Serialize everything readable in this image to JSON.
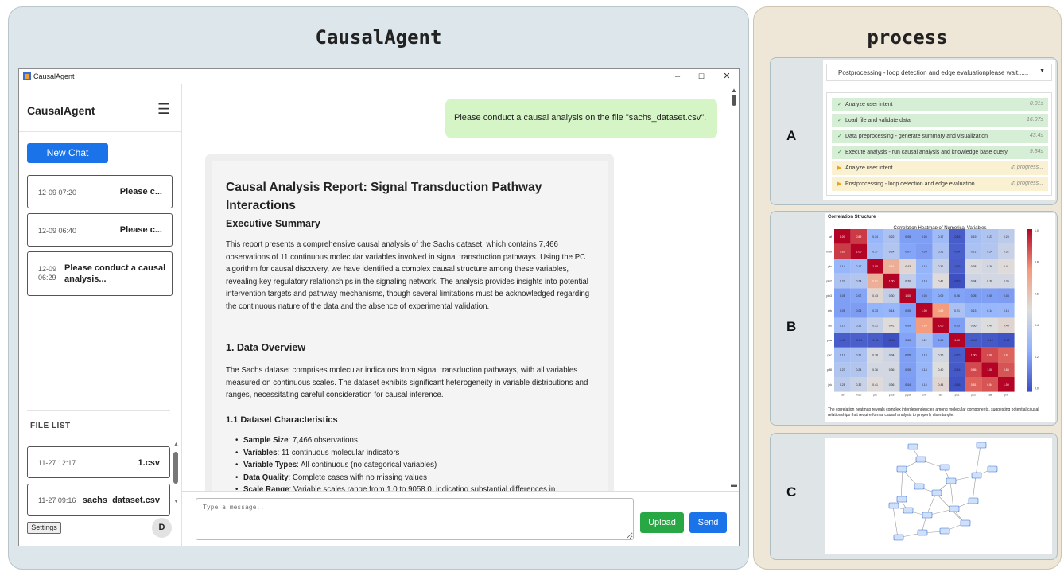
{
  "left_panel": {
    "title": "CausalAgent"
  },
  "right_panel": {
    "title": "process"
  },
  "window": {
    "app_name": "CausalAgent",
    "controls": {
      "minimize": "–",
      "maximize": "☐",
      "close": "✕"
    }
  },
  "sidebar": {
    "title": "CausalAgent",
    "menu_icon": "☰",
    "new_chat_label": "New Chat",
    "chats": [
      {
        "time": "12-09 07:20",
        "text": "Please c..."
      },
      {
        "time": "12-09 06:40",
        "text": "Please c..."
      },
      {
        "time_line1": "12-09",
        "time_line2": "06:29",
        "text_line1": "Please conduct a causal",
        "text_line2": "analysis..."
      }
    ],
    "file_list_label": "FILE LIST",
    "files": [
      {
        "time": "11-27 12:17",
        "name": "1.csv"
      },
      {
        "time": "11-27 09:16",
        "name": "sachs_dataset.csv"
      }
    ],
    "settings_label": "Settings",
    "avatar_letter": "D"
  },
  "chat": {
    "user_message": "Please conduct a causal analysis on the file \"sachs_dataset.csv\".",
    "report": {
      "title": "Causal Analysis Report: Signal Transduction Pathway Interactions",
      "exec_heading": "Executive Summary",
      "exec_text": "This report presents a comprehensive causal analysis of the Sachs dataset, which contains 7,466 observations of 11 continuous molecular variables involved in signal transduction pathways. Using the PC algorithm for causal discovery, we have identified a complex causal structure among these variables, revealing key regulatory relationships in the signaling network. The analysis provides insights into potential intervention targets and pathway mechanisms, though several limitations must be acknowledged regarding the continuous nature of the data and the absence of experimental validation.",
      "data_heading": "1. Data Overview",
      "data_text": "The Sachs dataset comprises molecular indicators from signal transduction pathways, with all variables measured on continuous scales. The dataset exhibits significant heterogeneity in variable distributions and ranges, necessitating careful consideration for causal inference.",
      "char_heading": "1.1 Dataset Characteristics",
      "bullets": [
        {
          "label": "Sample Size",
          "text": ": 7,466 observations"
        },
        {
          "label": "Variables",
          "text": ": 11 continuous molecular indicators"
        },
        {
          "label": "Variable Types",
          "text": ": All continuous (no categorical variables)"
        },
        {
          "label": "Data Quality",
          "text": ": Complete cases with no missing values"
        },
        {
          "label": "Scale Range",
          "text": ": Variable scales range from 1.0 to 9058.0, indicating substantial differences in"
        }
      ]
    },
    "input_placeholder": "Type a message...",
    "upload_label": "Upload",
    "send_label": "Send"
  },
  "process": {
    "A": {
      "label": "A",
      "header": "Postprocessing - loop detection and edge evaluationplease wait......",
      "header_arrow": "▼",
      "steps": [
        {
          "status": "done",
          "mark": "✓",
          "text": "Analyze user intent",
          "time": "0.01s"
        },
        {
          "status": "done",
          "mark": "✓",
          "text": "Load file and validate data",
          "time": "16.97s"
        },
        {
          "status": "done",
          "mark": "✓",
          "text": "Data preprocessing - generate summary and visualization",
          "time": "43.4s"
        },
        {
          "status": "done",
          "mark": "✓",
          "text": "Execute analysis - run causal analysis and knowledge base query",
          "time": "9.34s"
        },
        {
          "status": "prog",
          "mark": "▶",
          "text": "Analyze user intent",
          "time": "In progress..."
        },
        {
          "status": "prog",
          "mark": "▶",
          "text": "Postprocessing - loop detection and edge evaluation",
          "time": "In progress..."
        }
      ]
    },
    "B": {
      "label": "B",
      "section_title": "Correlation Structure",
      "heatmap_title": "Correlation Heatmap of Numerical Variables",
      "caption": "The correlation heatmap reveals complex interdependencies among molecular components, suggesting potential causal relationships that require formal causal analysis to properly disentangle.",
      "variables": [
        "raf",
        "mek",
        "plc",
        "pip2",
        "pip3",
        "erk",
        "akt",
        "pka",
        "pkc",
        "p38",
        "jnk"
      ],
      "colorbar_ticks": [
        "1.0",
        "0.8",
        "0.6",
        "0.4",
        "0.2",
        "0.0"
      ],
      "matrix": [
        [
          1.0,
          0.89,
          0.14,
          0.22,
          0.05,
          0.05,
          0.17,
          -0.15,
          0.19,
          0.23,
          0.28
        ],
        [
          0.89,
          1.0,
          0.17,
          0.24,
          0.07,
          0.04,
          0.21,
          -0.14,
          0.21,
          0.24,
          0.32
        ],
        [
          0.14,
          0.17,
          1.0,
          0.61,
          0.43,
          0.13,
          0.31,
          -0.15,
          0.38,
          0.36,
          0.41
        ],
        [
          0.22,
          0.24,
          0.61,
          1.0,
          0.3,
          0.14,
          0.41,
          -0.19,
          0.34,
          0.36,
          0.36
        ],
        [
          0.05,
          0.07,
          0.43,
          0.3,
          1.0,
          0.05,
          0.09,
          0.06,
          0.05,
          0.05,
          0.04
        ],
        [
          0.05,
          0.04,
          0.13,
          0.14,
          0.05,
          1.0,
          0.69,
          0.21,
          0.13,
          0.14,
          0.15
        ],
        [
          0.17,
          0.21,
          0.31,
          0.41,
          0.09,
          0.69,
          1.0,
          0.05,
          0.36,
          0.4,
          0.44
        ],
        [
          -0.15,
          -0.14,
          -0.15,
          -0.19,
          0.06,
          0.21,
          0.05,
          1.0,
          -0.15,
          -0.16,
          -0.18
        ],
        [
          0.19,
          0.21,
          0.38,
          0.34,
          0.05,
          0.13,
          0.36,
          -0.15,
          1.0,
          0.86,
          0.81
        ],
        [
          0.23,
          0.24,
          0.36,
          0.36,
          0.05,
          0.14,
          0.4,
          -0.16,
          0.86,
          1.0,
          0.84
        ],
        [
          0.28,
          0.32,
          0.41,
          0.36,
          0.04,
          0.15,
          0.44,
          -0.18,
          0.81,
          0.84,
          1.0
        ]
      ]
    },
    "C": {
      "label": "C"
    }
  }
}
